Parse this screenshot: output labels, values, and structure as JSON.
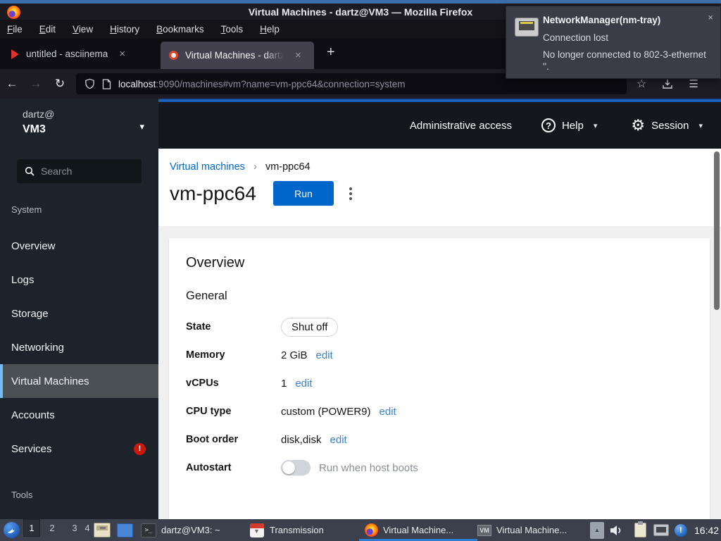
{
  "window": {
    "title": "Virtual Machines - dartz@VM3 — Mozilla Firefox"
  },
  "menubar": {
    "items": [
      "File",
      "Edit",
      "View",
      "History",
      "Bookmarks",
      "Tools",
      "Help"
    ]
  },
  "tabbar": {
    "tabs": [
      {
        "label": "untitled - asciinema",
        "close": "×"
      },
      {
        "label": "Virtual Machines - dartz@",
        "close": "×"
      }
    ],
    "new_tab": "+"
  },
  "navbar": {
    "back": "←",
    "forward": "→",
    "reload": "↻",
    "star": "☆",
    "menu": "☰",
    "url_host": "localhost",
    "url_rest": ":9090/machines#vm?name=vm-ppc64&connection=system"
  },
  "notification": {
    "title": "NetworkManager(nm-tray)",
    "close": "×",
    "line1": "Connection lost",
    "line2": "No longer connected to 802-3-ethernet ''."
  },
  "sidebar": {
    "user": "dartz@",
    "host": "VM3",
    "caret": "▾",
    "search_placeholder": "Search",
    "section_system": "System",
    "section_tools": "Tools",
    "items": [
      {
        "label": "Overview"
      },
      {
        "label": "Logs"
      },
      {
        "label": "Storage"
      },
      {
        "label": "Networking"
      },
      {
        "label": "Virtual Machines"
      },
      {
        "label": "Accounts"
      },
      {
        "label": "Services"
      }
    ],
    "services_badge": "!"
  },
  "masthead": {
    "admin_access": "Administrative access",
    "help_label": "Help",
    "help_glyph": "?",
    "session_label": "Session",
    "gear_glyph": "⚙",
    "caret": "▾"
  },
  "page": {
    "breadcrumb_link": "Virtual machines",
    "breadcrumb_sep": "›",
    "breadcrumb_current": "vm-ppc64",
    "title": "vm-ppc64",
    "run_label": "Run"
  },
  "overview": {
    "heading": "Overview",
    "subheading": "General",
    "edit_label": "edit",
    "rows": {
      "state": {
        "label": "State",
        "value": "Shut off"
      },
      "memory": {
        "label": "Memory",
        "value": "2 GiB"
      },
      "vcpus": {
        "label": "vCPUs",
        "value": "1"
      },
      "cpu_type": {
        "label": "CPU type",
        "value": "custom (POWER9)"
      },
      "boot_order": {
        "label": "Boot order",
        "value": "disk,disk"
      },
      "autostart": {
        "label": "Autostart",
        "value": "Run when host boots"
      }
    }
  },
  "taskbar": {
    "workspaces": [
      "1",
      "2",
      "3",
      "4"
    ],
    "terminal_glyph": ">_",
    "vm_icon_text": "VM",
    "tasks": {
      "terminal": "dartz@VM3: ~",
      "transmission": "Transmission",
      "firefox": "Virtual Machine...",
      "vmware": "Virtual Machine..."
    },
    "tray_expand": "▲",
    "ball_glyph": "!",
    "clock": "16:42"
  },
  "colors": {
    "accent_blue": "#1e63c0",
    "link_blue": "#0066cc",
    "edit_blue": "#3a81d2",
    "selected_accent": "#73bcf7",
    "badge_red": "#c9190b"
  }
}
